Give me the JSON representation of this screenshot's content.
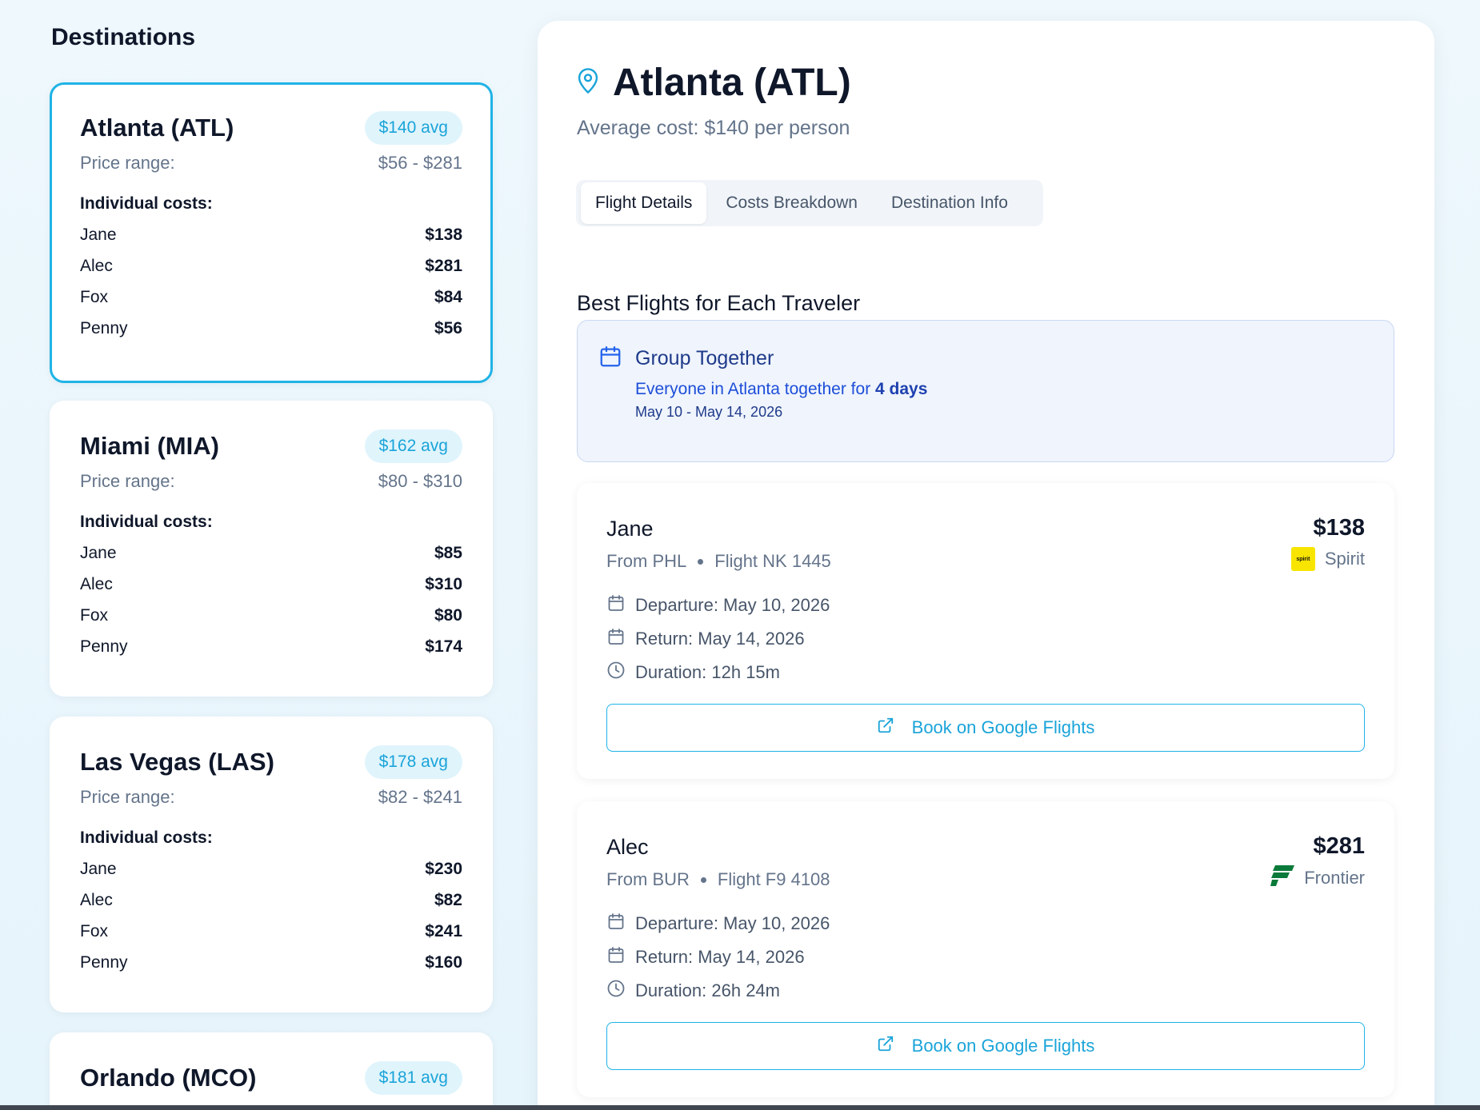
{
  "sidebar": {
    "title": "Destinations",
    "destinations": [
      {
        "name": "Atlanta (ATL)",
        "avg": "$140 avg",
        "range_label": "Price range:",
        "range": "$56 - $281",
        "individual_label": "Individual costs:",
        "costs": [
          {
            "name": "Jane",
            "value": "$138"
          },
          {
            "name": "Alec",
            "value": "$281"
          },
          {
            "name": "Fox",
            "value": "$84"
          },
          {
            "name": "Penny",
            "value": "$56"
          }
        ]
      },
      {
        "name": "Miami (MIA)",
        "avg": "$162 avg",
        "range_label": "Price range:",
        "range": "$80 - $310",
        "individual_label": "Individual costs:",
        "costs": [
          {
            "name": "Jane",
            "value": "$85"
          },
          {
            "name": "Alec",
            "value": "$310"
          },
          {
            "name": "Fox",
            "value": "$80"
          },
          {
            "name": "Penny",
            "value": "$174"
          }
        ]
      },
      {
        "name": "Las Vegas (LAS)",
        "avg": "$178 avg",
        "range_label": "Price range:",
        "range": "$82 - $241",
        "individual_label": "Individual costs:",
        "costs": [
          {
            "name": "Jane",
            "value": "$230"
          },
          {
            "name": "Alec",
            "value": "$82"
          },
          {
            "name": "Fox",
            "value": "$241"
          },
          {
            "name": "Penny",
            "value": "$160"
          }
        ]
      },
      {
        "name": "Orlando (MCO)",
        "avg": "$181 avg"
      }
    ]
  },
  "detail": {
    "title": "Atlanta (ATL)",
    "subtitle": "Average cost: $140 per person",
    "tabs": [
      "Flight Details",
      "Costs Breakdown",
      "Destination Info"
    ],
    "section_title": "Best Flights for Each Traveler",
    "group": {
      "title": "Group Together",
      "text_prefix": "Everyone in Atlanta together for ",
      "text_bold": "4 days",
      "dates": "May 10 - May 14, 2026"
    },
    "travelers": [
      {
        "name": "Jane",
        "from": "From PHL",
        "flight": "Flight NK 1445",
        "price": "$138",
        "airline": "Spirit",
        "airline_logo_text": "spirit",
        "departure": "Departure: May 10, 2026",
        "return": "Return: May 14, 2026",
        "duration": "Duration: 12h 15m",
        "book_label": "Book on Google Flights"
      },
      {
        "name": "Alec",
        "from": "From BUR",
        "flight": "Flight F9 4108",
        "price": "$281",
        "airline": "Frontier",
        "departure": "Departure: May 10, 2026",
        "return": "Return: May 14, 2026",
        "duration": "Duration: 26h 24m",
        "book_label": "Book on Google Flights"
      }
    ]
  },
  "colors": {
    "accent": "#1fb3e6",
    "badge_bg": "#e0f4fc",
    "group_bg": "#eff4fd",
    "group_text": "#1e3a8a",
    "spirit_yellow": "#f7e500",
    "frontier_green": "#0a7a3b"
  },
  "icons": {
    "location": "map-pin-icon",
    "calendar": "calendar-icon",
    "clock": "clock-icon",
    "external": "external-link-icon"
  }
}
